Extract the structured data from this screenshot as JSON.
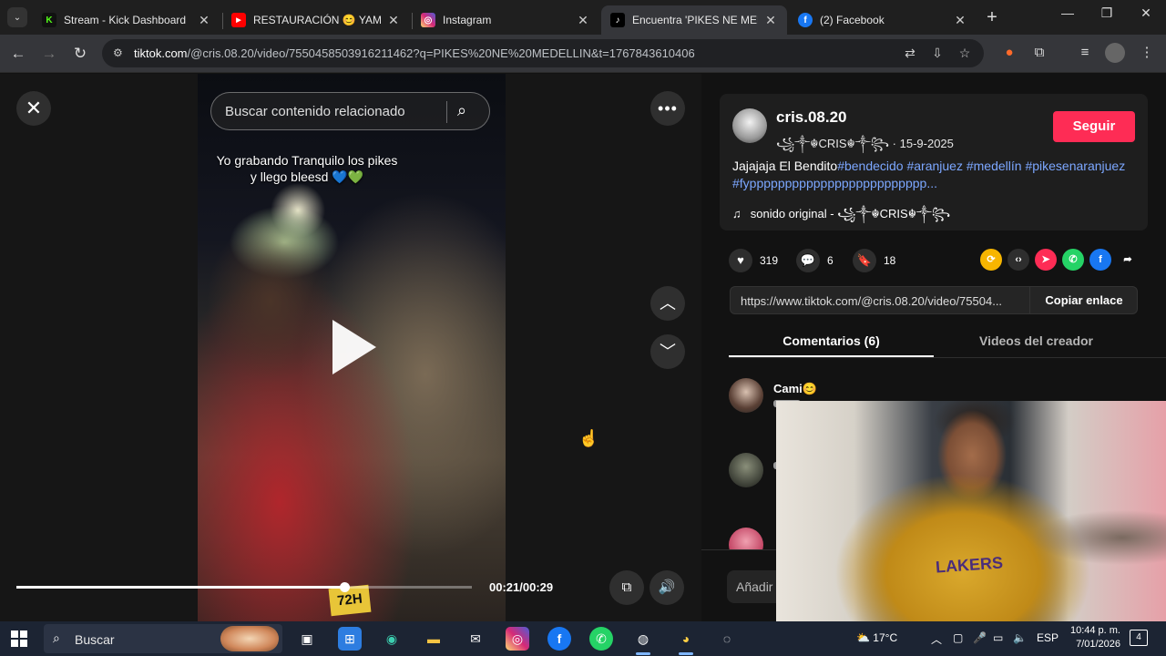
{
  "browser": {
    "tabs": [
      {
        "title": "Stream - Kick Dashboard",
        "favicon": "K",
        "favicon_color": "#53fc18"
      },
      {
        "title": "RESTAURACIÓN 😊 YAMAHA",
        "favicon": "▶",
        "favicon_color": "#ff0000"
      },
      {
        "title": "Instagram",
        "favicon": "◎",
        "favicon_color": "#e1306c"
      },
      {
        "title": "Encuentra 'PIKES NE MEDELL",
        "favicon": "♪",
        "favicon_color": "#010101"
      },
      {
        "title": "(2) Facebook",
        "favicon": "f",
        "favicon_color": "#1877f2"
      }
    ],
    "url_domain": "tiktok.com",
    "url_path": "/@cris.08.20/video/7550458503916211462?q=PIKES%20NE%20MEDELLIN&t=1767843610406"
  },
  "video": {
    "search_placeholder": "Buscar contenido relacionado",
    "caption": "Yo grabando Tranquilo los pikes y llego bleesd 💙💚",
    "plate_text": "72H",
    "time": "00:21/00:29",
    "progress_fraction": 0.72
  },
  "panel": {
    "username": "cris.08.20",
    "display_name": "꧁༒☬CRIS☬༒꧂",
    "date": "15-9-2025",
    "follow_label": "Seguir",
    "description_text": "Jajajaja El Bendito",
    "description_tags": "#bendecido #aranjuez #medellín #pikesenaranjuez #fyppppppppppppppppppppppppp...",
    "music_label": "sonido original - ꧁༒☬CRIS☬༒꧂",
    "likes": "319",
    "comments_count": "6",
    "saves": "18",
    "share_link": "https://www.tiktok.com/@cris.08.20/video/75504...",
    "copy_label": "Copiar enlace",
    "tab_comments": "Comentarios (6)",
    "tab_creator": "Videos del creador",
    "first_commenter": "Cami😊",
    "add_comment_placeholder": "Añadir comentario..."
  },
  "taskbar": {
    "search_label": "Buscar",
    "weather": "17°C",
    "language": "ESP",
    "time": "10:44 p. m.",
    "date": "7/01/2026",
    "notifications": "4"
  },
  "colors": {
    "accent": "#fe2c55",
    "hashtag": "#7ca7ff"
  }
}
